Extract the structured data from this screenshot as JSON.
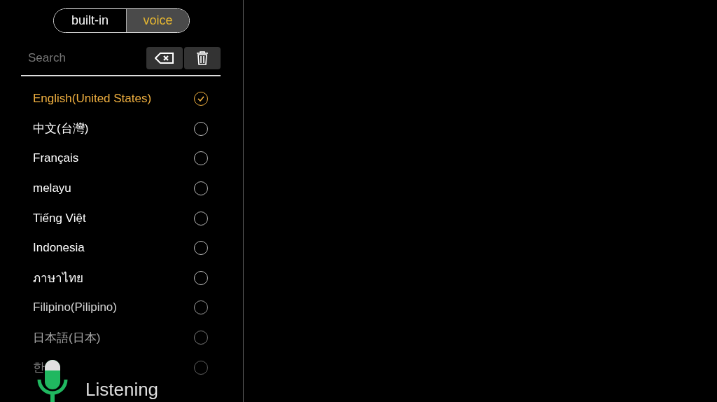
{
  "mode_toggle": [
    {
      "label": "built-in",
      "selected": false
    },
    {
      "label": "voice",
      "selected": true
    }
  ],
  "search": {
    "placeholder": "Search"
  },
  "languages": [
    {
      "label": "English(United States)",
      "selected": true
    },
    {
      "label": "中文(台灣)",
      "selected": false
    },
    {
      "label": "Français",
      "selected": false
    },
    {
      "label": "melayu",
      "selected": false
    },
    {
      "label": "Tiếng Việt",
      "selected": false
    },
    {
      "label": "Indonesia",
      "selected": false
    },
    {
      "label": "ภาษาไทย",
      "selected": false
    },
    {
      "label": "Filipino(Pilipino)",
      "selected": false
    },
    {
      "label": "日本語(日本)",
      "selected": false
    },
    {
      "label": "한",
      "selected": false
    }
  ],
  "voice_status": {
    "label": "Listening"
  }
}
